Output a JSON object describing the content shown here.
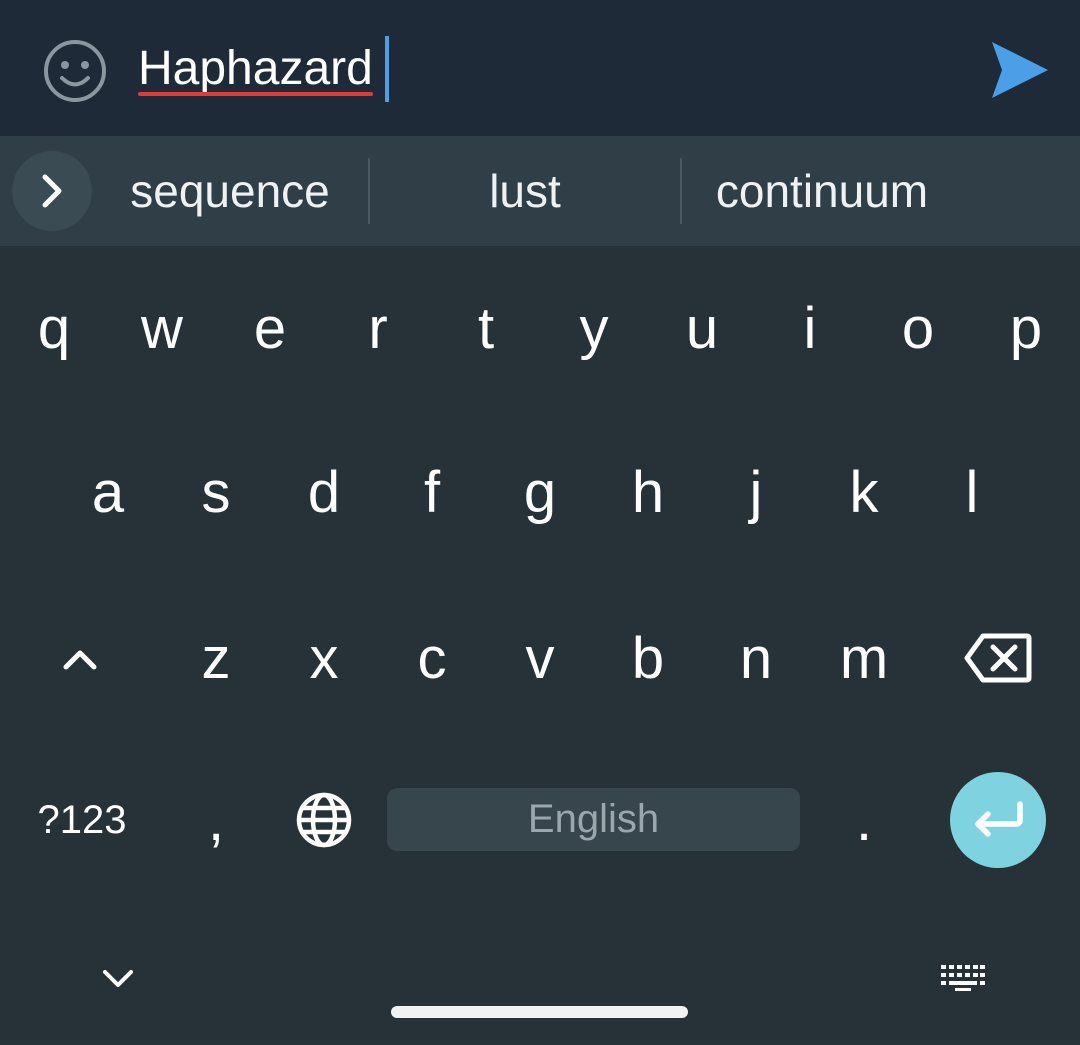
{
  "input": {
    "text": "Haphazard",
    "emoji_icon": "smiley-face-icon",
    "send_icon": "send-arrow-icon",
    "underline_color": "#e53935",
    "cursor_color": "#4a9fe6",
    "send_color": "#4a9fe6"
  },
  "suggestions": {
    "expand_icon": "chevron-right-icon",
    "items": [
      "sequence",
      "lust",
      "continuum"
    ]
  },
  "keyboard": {
    "row1": [
      "q",
      "w",
      "e",
      "r",
      "t",
      "y",
      "u",
      "i",
      "o",
      "p"
    ],
    "row2": [
      "a",
      "s",
      "d",
      "f",
      "g",
      "h",
      "j",
      "k",
      "l"
    ],
    "row3": [
      "z",
      "x",
      "c",
      "v",
      "b",
      "n",
      "m"
    ],
    "shift_icon": "caret-up-icon",
    "backspace_icon": "backspace-icon",
    "symbols_label": "?123",
    "comma_label": ",",
    "globe_icon": "globe-icon",
    "space_label": "English",
    "period_label": ".",
    "enter_icon": "enter-return-icon",
    "enter_color": "#7fd3e0"
  },
  "nav": {
    "hide_keyboard_icon": "chevron-down-icon",
    "switch_keyboard_icon": "keyboard-icon"
  }
}
